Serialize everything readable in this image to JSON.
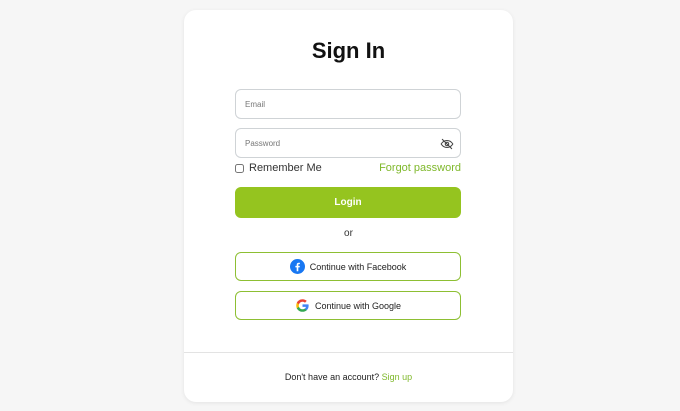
{
  "title": "Sign In",
  "form": {
    "email_placeholder": "Email",
    "email_value": "",
    "password_placeholder": "Password",
    "password_value": "",
    "password_visibility_icon": "eye-off-icon",
    "remember_label": "Remember Me",
    "remember_checked": false,
    "forgot_label": "Forgot password",
    "login_label": "Login"
  },
  "divider_text": "or",
  "social": {
    "facebook_label": "Continue with Facebook",
    "facebook_icon": "facebook-icon",
    "google_label": "Continue with Google",
    "google_icon": "google-icon"
  },
  "footer": {
    "prompt": "Don't have an account?",
    "signup_label": "Sign up"
  },
  "colors": {
    "accent": "#95c41f",
    "link": "#7fb82b",
    "facebook": "#1877f2"
  }
}
